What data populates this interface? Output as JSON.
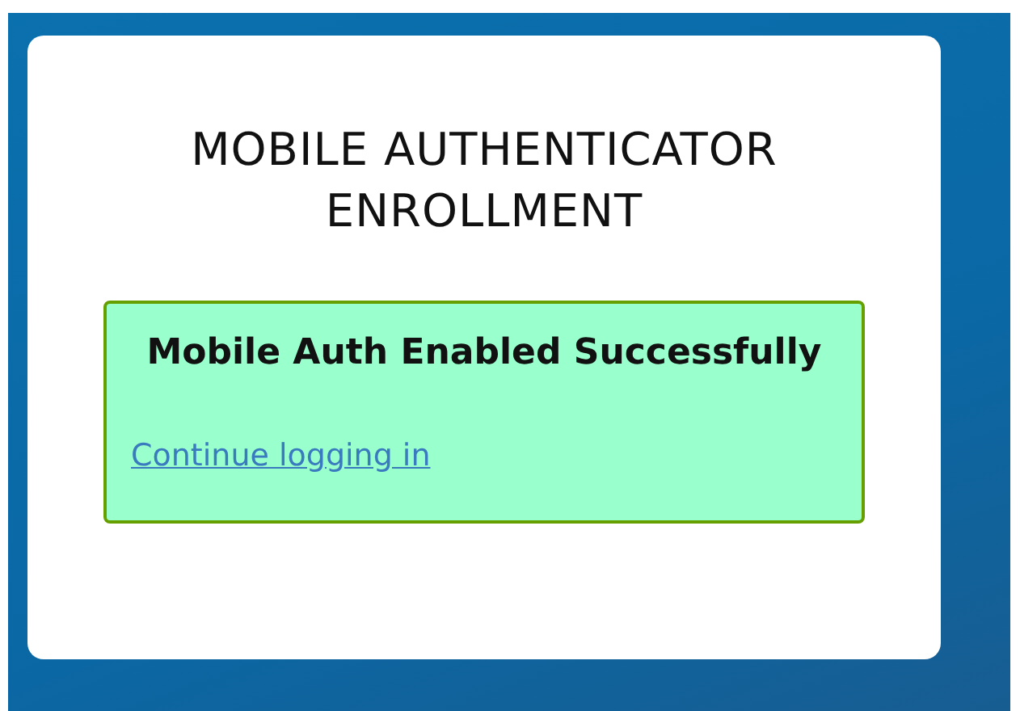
{
  "title": "MOBILE AUTHENTICATOR ENROLLMENT",
  "alert": {
    "heading": "Mobile Auth Enabled Successfully",
    "link": "Continue logging in"
  }
}
